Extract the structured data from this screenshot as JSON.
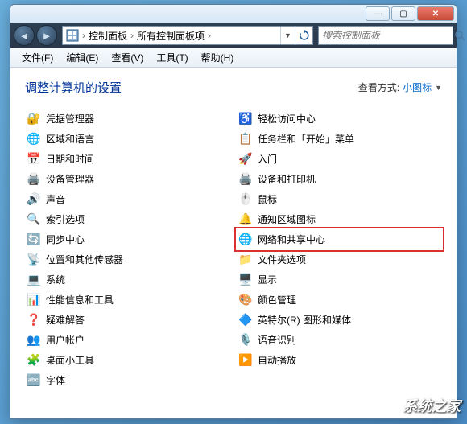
{
  "titlebar": {
    "min": "—",
    "max": "▢",
    "close": "✕"
  },
  "nav": {
    "back": "◄",
    "forward": "►"
  },
  "breadcrumb": {
    "seg1": "控制面板",
    "seg2": "所有控制面板项",
    "sep": "›"
  },
  "search": {
    "placeholder": "搜索控制面板"
  },
  "menu": {
    "file": "文件(F)",
    "edit": "编辑(E)",
    "view": "查看(V)",
    "tools": "工具(T)",
    "help": "帮助(H)"
  },
  "page": {
    "title": "调整计算机的设置",
    "viewby_label": "查看方式:",
    "viewby_value": "小图标"
  },
  "items_left": [
    {
      "icon": "🔐",
      "label": "凭据管理器"
    },
    {
      "icon": "🌐",
      "label": "区域和语言"
    },
    {
      "icon": "📅",
      "label": "日期和时间"
    },
    {
      "icon": "🖨️",
      "label": "设备管理器"
    },
    {
      "icon": "🔊",
      "label": "声音"
    },
    {
      "icon": "🔍",
      "label": "索引选项"
    },
    {
      "icon": "🔄",
      "label": "同步中心"
    },
    {
      "icon": "📡",
      "label": "位置和其他传感器"
    },
    {
      "icon": "💻",
      "label": "系统"
    },
    {
      "icon": "📊",
      "label": "性能信息和工具"
    },
    {
      "icon": "❓",
      "label": "疑难解答"
    },
    {
      "icon": "👥",
      "label": "用户帐户"
    },
    {
      "icon": "🧩",
      "label": "桌面小工具"
    },
    {
      "icon": "🔤",
      "label": "字体"
    }
  ],
  "items_right": [
    {
      "icon": "♿",
      "label": "轻松访问中心"
    },
    {
      "icon": "📋",
      "label": "任务栏和「开始」菜单"
    },
    {
      "icon": "🚀",
      "label": "入门"
    },
    {
      "icon": "🖨️",
      "label": "设备和打印机"
    },
    {
      "icon": "🖱️",
      "label": "鼠标"
    },
    {
      "icon": "🔔",
      "label": "通知区域图标"
    },
    {
      "icon": "🌐",
      "label": "网络和共享中心",
      "highlight": true
    },
    {
      "icon": "📁",
      "label": "文件夹选项"
    },
    {
      "icon": "🖥️",
      "label": "显示"
    },
    {
      "icon": "🎨",
      "label": "颜色管理"
    },
    {
      "icon": "🔷",
      "label": "英特尔(R) 图形和媒体"
    },
    {
      "icon": "🎙️",
      "label": "语音识别"
    },
    {
      "icon": "▶️",
      "label": "自动播放"
    }
  ],
  "watermark": "系统之家"
}
